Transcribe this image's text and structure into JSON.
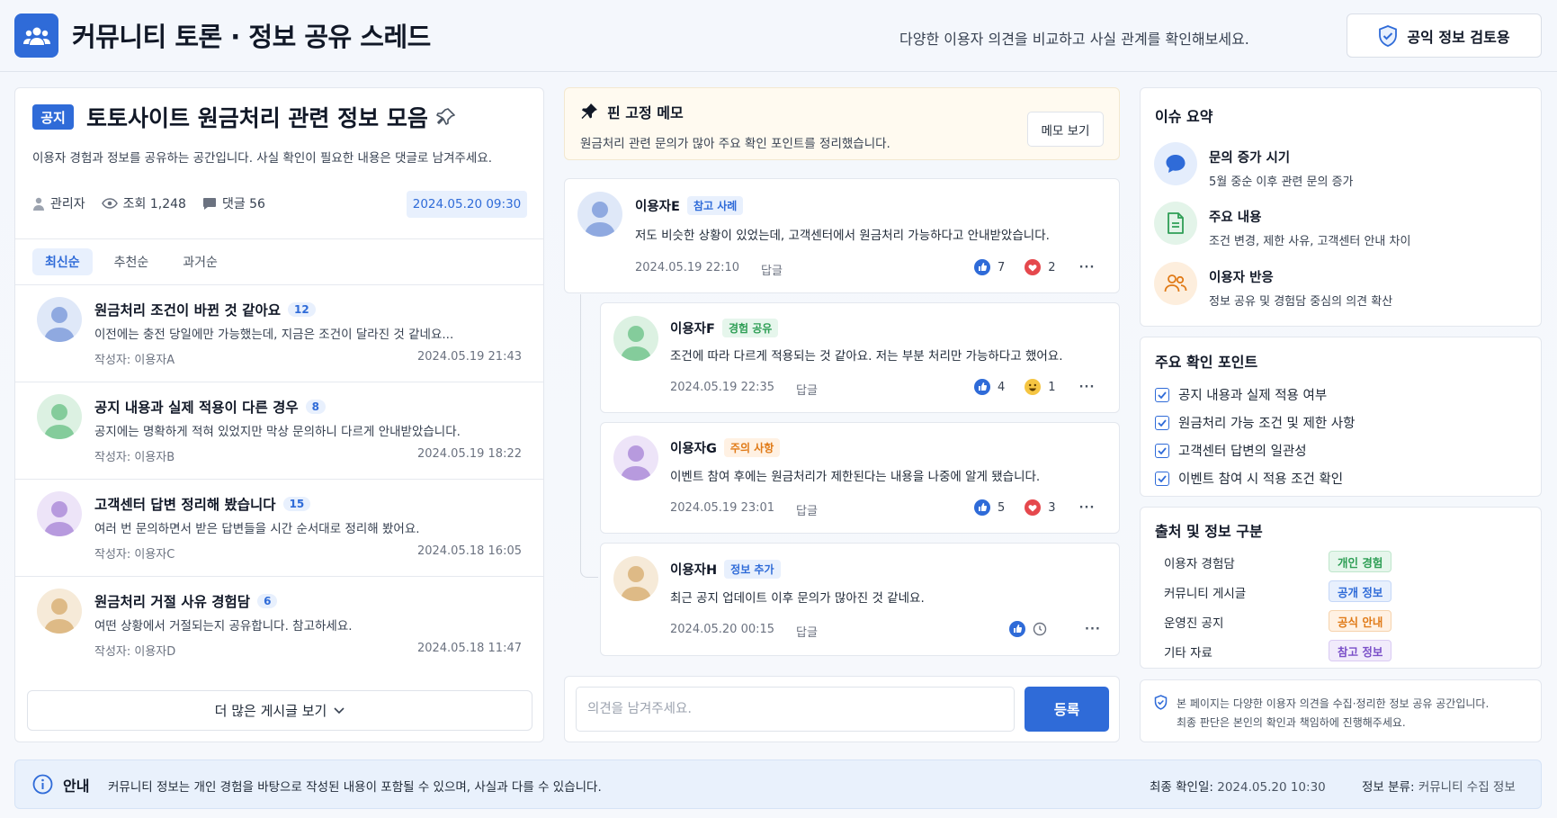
{
  "header": {
    "title": "커뮤니티 토론 · 정보 공유 스레드",
    "description": "다양한 이용자 의견을 비교하고 사실 관계를 확인해보세요.",
    "review_button": "공익 정보 검토용",
    "logo_icon": "users-icon",
    "accent": "#2f6bd8"
  },
  "post": {
    "badge": "공지",
    "title": "토토사이트 원금처리 관련 정보 모음",
    "description": "이용자 경험과 정보를 공유하는 공간입니다. 사실 확인이 필요한 내용은 댓글로 남겨주세요.",
    "author": "관리자",
    "views": "조회 1,248",
    "comments": "댓글 56",
    "date": "2024.05.20 09:30"
  },
  "sort_tabs": [
    "최신순",
    "추천순",
    "과거순"
  ],
  "posts": [
    {
      "title": "원금처리 조건이 바뀐 것 같아요",
      "count": "12",
      "excerpt": "이전에는 충전 당일에만 가능했는데, 지금은 조건이 달라진 것 같네요...",
      "author": "작성자: 이용자A",
      "date": "2024.05.19 21:43",
      "color": "#6f8fd6"
    },
    {
      "title": "공지 내용과 실제 적용이 다른 경우",
      "count": "8",
      "excerpt": "공지에는 명확하게 적혀 있었지만 막상 문의하니 다르게 안내받았습니다.",
      "author": "작성자: 이용자B",
      "date": "2024.05.19 18:22",
      "color": "#6fc08a"
    },
    {
      "title": "고객센터 답변 정리해 봤습니다",
      "count": "15",
      "excerpt": "여러 번 문의하면서 받은 답변들을 시간 순서대로 정리해 봤어요.",
      "author": "작성자: 이용자C",
      "date": "2024.05.18 16:05",
      "color": "#a98bd1"
    },
    {
      "title": "원금처리 거절 사유 경험담",
      "count": "6",
      "excerpt": "여떤 상황에서 거절되는지 공유합니다. 참고하세요.",
      "author": "작성자: 이용자D",
      "date": "2024.05.18 11:47",
      "color": "#d9b27c"
    }
  ],
  "more_posts_label": "더 많은 게시글 보기",
  "pinned": {
    "title": "핀 고정 메모",
    "description": "원금처리 관련 문의가 많아 주요 확인 포인트를 정리했습니다.",
    "button": "메모 보기"
  },
  "comments": [
    {
      "name": "이용자E",
      "tag": "참고 사례",
      "text": "저도 비슷한 상황이 있었는데, 고객센터에서 원금처리 가능하다고 안내받았습니다.",
      "date": "2024.05.19 22:10",
      "reply": "답글",
      "likes": "7",
      "second": "2",
      "second_icon": "heart-icon"
    },
    {
      "name": "이용자F",
      "tag": "경험 공유",
      "text": "조건에 따라 다르게 적용되는 것 같아요. 저는 부분 처리만 가능하다고 했어요.",
      "date": "2024.05.19 22:35",
      "reply": "답글",
      "likes": "4",
      "second": "1",
      "second_icon": "smile-icon"
    },
    {
      "name": "이용자G",
      "tag": "주의 사항",
      "text": "이벤트 참여 후에는 원금처리가 제한된다는 내용을 나중에 알게 됐습니다.",
      "date": "2024.05.19 23:01",
      "reply": "답글",
      "likes": "5",
      "second": "3",
      "second_icon": "heart-icon"
    },
    {
      "name": "이용자H",
      "tag": "정보 추가",
      "text": "최근 공지 업데이트 이후 문의가 많아진 것 같네요.",
      "date": "2024.05.20 00:15",
      "reply": "답글"
    }
  ],
  "composer": {
    "placeholder": "의견을 남겨주세요.",
    "submit": "등록"
  },
  "summary": {
    "heading": "이슈 요약",
    "items": [
      {
        "title": "문의 증가 시기",
        "desc": "5월 중순 이후 관련 문의 증가",
        "icon": "chat-icon"
      },
      {
        "title": "주요 내용",
        "desc": "조건 변경, 제한 사유, 고객센터 안내 차이",
        "icon": "document-icon"
      },
      {
        "title": "이용자 반응",
        "desc": "정보 공유 및 경험담 중심의 의견 확산",
        "icon": "users-icon"
      }
    ]
  },
  "checks": {
    "heading": "주요 확인 포인트",
    "items": [
      "공지 내용과 실제 적용 여부",
      "원금처리 가능 조건 및 제한 사항",
      "고객센터 답변의 일관성",
      "이벤트 참여 시 적용 조건 확인"
    ]
  },
  "sources": {
    "heading": "출처 및 정보 구분",
    "rows": [
      {
        "label": "이용자 경험담",
        "tag": "개인 경험"
      },
      {
        "label": "커뮤니티 게시글",
        "tag": "공개 정보"
      },
      {
        "label": "운영진 공지",
        "tag": "공식 안내"
      },
      {
        "label": "기타 자료",
        "tag": "참고 정보"
      }
    ]
  },
  "disclaimer": {
    "line1": "본 페이지는 다양한 이용자 의견을 수집·정리한 정보 공유 공간입니다.",
    "line2": "최종 판단은 본인의 확인과 책임하에 진행해주세요."
  },
  "footer": {
    "label": "안내",
    "text": "커뮤니티 정보는 개인 경험을 바탕으로 작성된 내용이 포함될 수 있으며, 사실과 다를 수 있습니다.",
    "checked_label": "최종 확인일:",
    "checked_value": "2024.05.20 10:30",
    "category_label": "정보 분류:",
    "category_value": "커뮤니티 수집 정보"
  }
}
